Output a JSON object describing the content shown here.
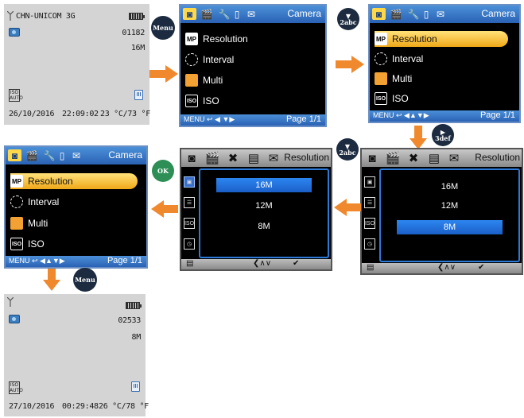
{
  "screen1": {
    "carrier": "CHN-UNICOM 3G",
    "shots_remaining": "01182",
    "image_size": "16M",
    "iso": {
      "top": "ISO",
      "bottom": "AUTO"
    },
    "date": "26/10/2016",
    "time": "22:09:02",
    "temp": "23 °C/73 °F"
  },
  "menu_button": "Menu",
  "down_abc_button": {
    "arrow": "▼",
    "label": "2abc"
  },
  "right_def_button": {
    "arrow": "▶",
    "label": "3def"
  },
  "ok_button": "OK",
  "camera_menu": {
    "title": "Camera",
    "items": [
      {
        "icon": "MP",
        "label": "Resolution"
      },
      {
        "icon": "interval-icon",
        "label": "Interval"
      },
      {
        "icon": "multi-icon",
        "label": "Multi"
      },
      {
        "icon": "ISO",
        "label": "ISO"
      }
    ],
    "footer_left": "MENU ↩ ◀  ▼▶",
    "footer_left_2": "MENU ↩ ◀▲▼▶",
    "page": "Page  1/1"
  },
  "resolution_menu": {
    "title": "Resolution",
    "options": [
      "16M",
      "12M",
      "8M"
    ],
    "footer": "❮∧∨",
    "check": "✔"
  },
  "screen_final": {
    "shots_remaining": "02533",
    "image_size": "8M",
    "iso": {
      "top": "ISO",
      "bottom": "AUTO"
    },
    "date": "27/10/2016",
    "time": "00:29:48",
    "temp": "26 °C/78 °F"
  },
  "colors": {
    "arrow": "#f0892e",
    "menu_bar": "#3a78c8",
    "highlight": "#f5b530"
  }
}
